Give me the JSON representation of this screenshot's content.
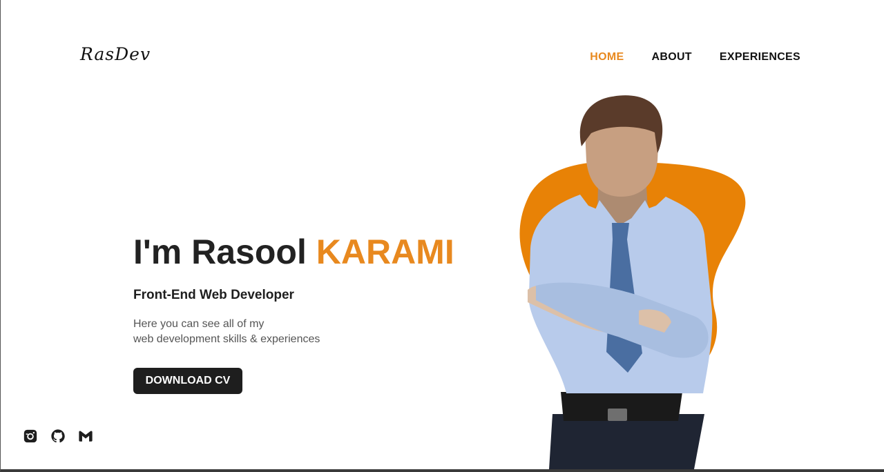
{
  "brand": {
    "logo_text": "RasDev"
  },
  "nav": {
    "items": [
      {
        "label": "HOME",
        "active": true
      },
      {
        "label": "ABOUT",
        "active": false
      },
      {
        "label": "EXPERIENCES",
        "active": false
      }
    ]
  },
  "hero": {
    "title_prefix": "I'm Rasool",
    "title_accent": "KARAMI",
    "subtitle": "Front-End Web Developer",
    "description_line1": "Here you can see all of my",
    "description_line2": "web development skills & experiences",
    "cta_label": "DOWNLOAD CV"
  },
  "socials": [
    {
      "icon": "instagram-icon"
    },
    {
      "icon": "github-icon"
    },
    {
      "icon": "gmail-icon"
    }
  ],
  "colors": {
    "accent": "#e8891f",
    "dark": "#1e1e1e",
    "blob": "#e88206"
  }
}
